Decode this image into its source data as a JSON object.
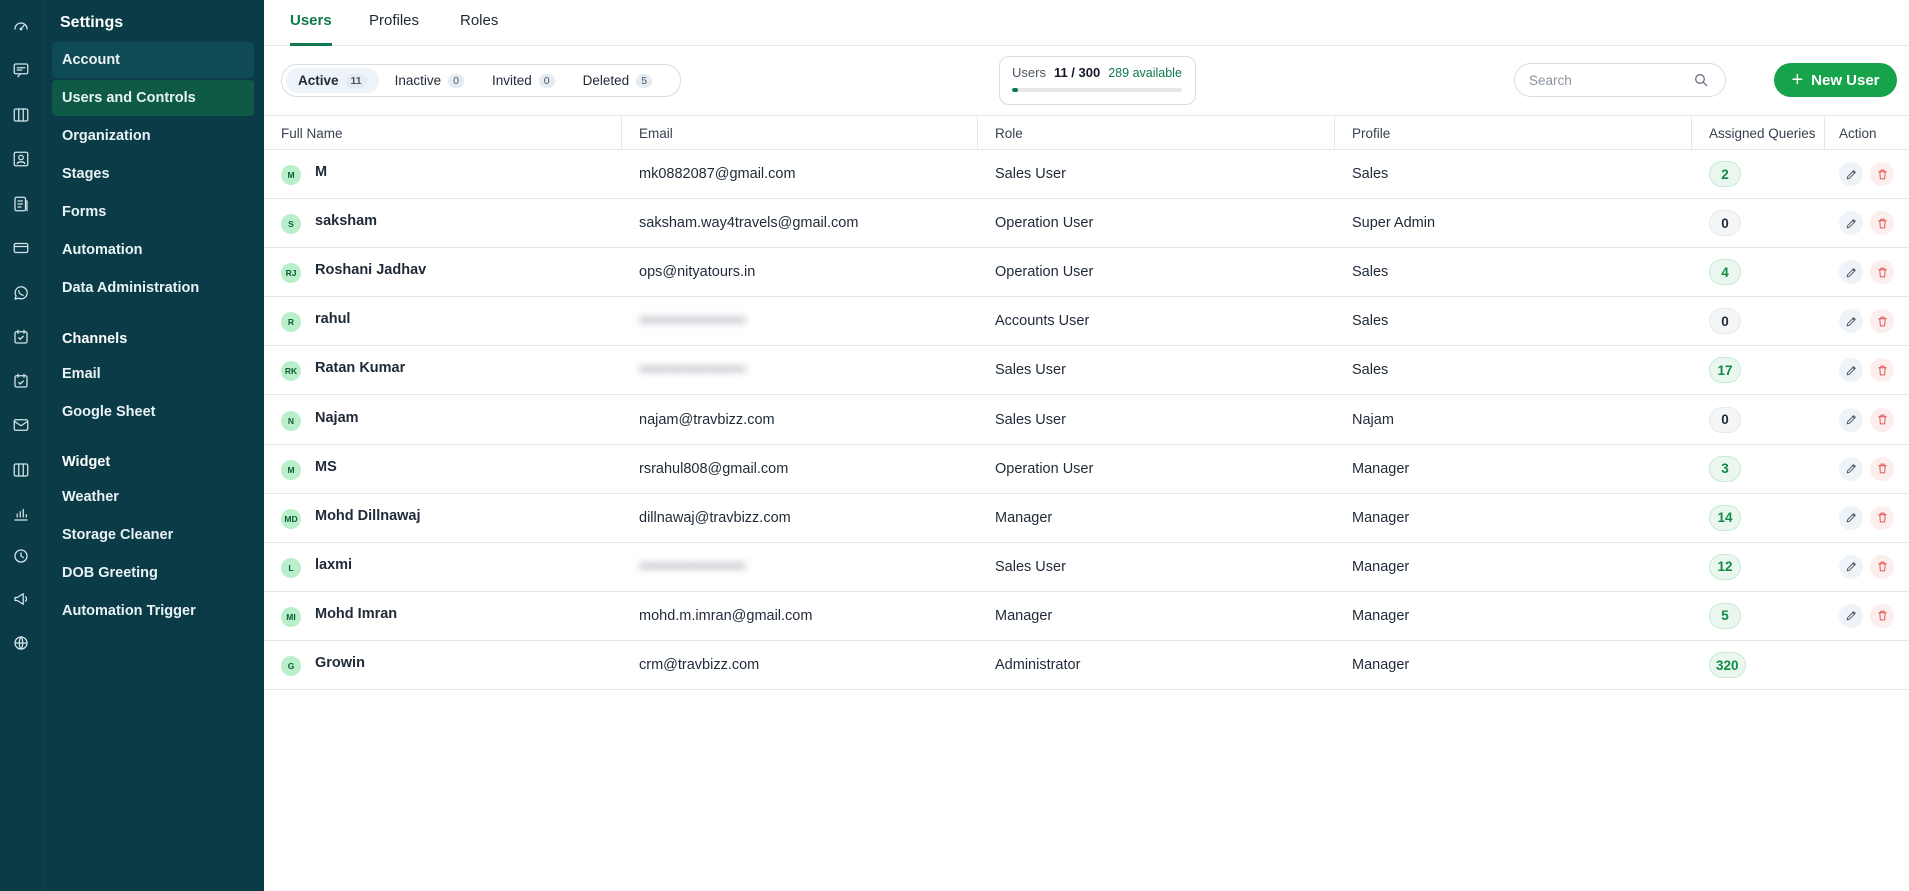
{
  "rail": {
    "icons": [
      "dashboard-icon",
      "chat-icon",
      "board-icon",
      "contacts-icon",
      "reports-icon",
      "payments-icon",
      "whatsapp-icon",
      "tasks-icon",
      "calendar-icon",
      "email-icon",
      "map-icon",
      "analytics-icon",
      "history-icon",
      "campaign-icon",
      "globe-icon"
    ]
  },
  "sidebar": {
    "title": "Settings",
    "items": [
      {
        "label": "Account"
      },
      {
        "label": "Users and Controls"
      },
      {
        "label": "Organization"
      },
      {
        "label": "Stages"
      },
      {
        "label": "Forms"
      },
      {
        "label": "Automation"
      },
      {
        "label": "Data Administration"
      }
    ],
    "channels": {
      "title": "Channels",
      "items": [
        {
          "label": "Email"
        },
        {
          "label": "Google Sheet"
        }
      ]
    },
    "widget": {
      "title": "Widget",
      "items": [
        {
          "label": "Weather"
        },
        {
          "label": "Storage Cleaner"
        },
        {
          "label": "DOB Greeting"
        },
        {
          "label": "Automation Trigger"
        }
      ]
    }
  },
  "tabs": [
    {
      "label": "Users"
    },
    {
      "label": "Profiles"
    },
    {
      "label": "Roles"
    }
  ],
  "filters": [
    {
      "label": "Active",
      "count": "11"
    },
    {
      "label": "Inactive",
      "count": "0"
    },
    {
      "label": "Invited",
      "count": "0"
    },
    {
      "label": "Deleted",
      "count": "5"
    }
  ],
  "quota": {
    "label": "Users",
    "value": "11 / 300",
    "available": "289 available",
    "used_fraction": 0.037
  },
  "search": {
    "placeholder": "Search"
  },
  "new_user_label": "New User",
  "columns": {
    "full_name": "Full Name",
    "email": "Email",
    "role": "Role",
    "profile": "Profile",
    "assigned": "Assigned Queries",
    "action": "Action"
  },
  "users": [
    {
      "initials": "M",
      "name": "M",
      "email": "mk0882087@gmail.com",
      "role": "Sales User",
      "profile": "Sales",
      "queries": "2"
    },
    {
      "initials": "S",
      "name": "saksham",
      "email": "saksham.way4travels@gmail.com",
      "role": "Operation User",
      "profile": "Super Admin",
      "queries": "0"
    },
    {
      "initials": "RJ",
      "name": "Roshani Jadhav",
      "email": "ops@nityatours.in",
      "role": "Operation User",
      "profile": "Sales",
      "queries": "4"
    },
    {
      "initials": "R",
      "name": "rahul",
      "email": "",
      "role": "Accounts User",
      "profile": "Sales",
      "queries": "0"
    },
    {
      "initials": "RK",
      "name": "Ratan Kumar",
      "email": "",
      "role": "Sales User",
      "profile": "Sales",
      "queries": "17"
    },
    {
      "initials": "N",
      "name": "Najam",
      "email": "najam@travbizz.com",
      "role": "Sales User",
      "profile": "Najam",
      "queries": "0"
    },
    {
      "initials": "M",
      "name": "MS",
      "email": "rsrahul808@gmail.com",
      "role": "Operation User",
      "profile": "Manager",
      "queries": "3"
    },
    {
      "initials": "MD",
      "name": "Mohd Dillnawaj",
      "email": "dillnawaj@travbizz.com",
      "role": "Manager",
      "profile": "Manager",
      "queries": "14"
    },
    {
      "initials": "L",
      "name": "laxmi",
      "email": "",
      "role": "Sales User",
      "profile": "Manager",
      "queries": "12"
    },
    {
      "initials": "MI",
      "name": "Mohd Imran",
      "email": "mohd.m.imran@gmail.com",
      "role": "Manager",
      "profile": "Manager",
      "queries": "5"
    },
    {
      "initials": "G",
      "name": "Growin",
      "email": "crm@travbizz.com",
      "role": "Administrator",
      "profile": "Manager",
      "queries": "320"
    }
  ]
}
